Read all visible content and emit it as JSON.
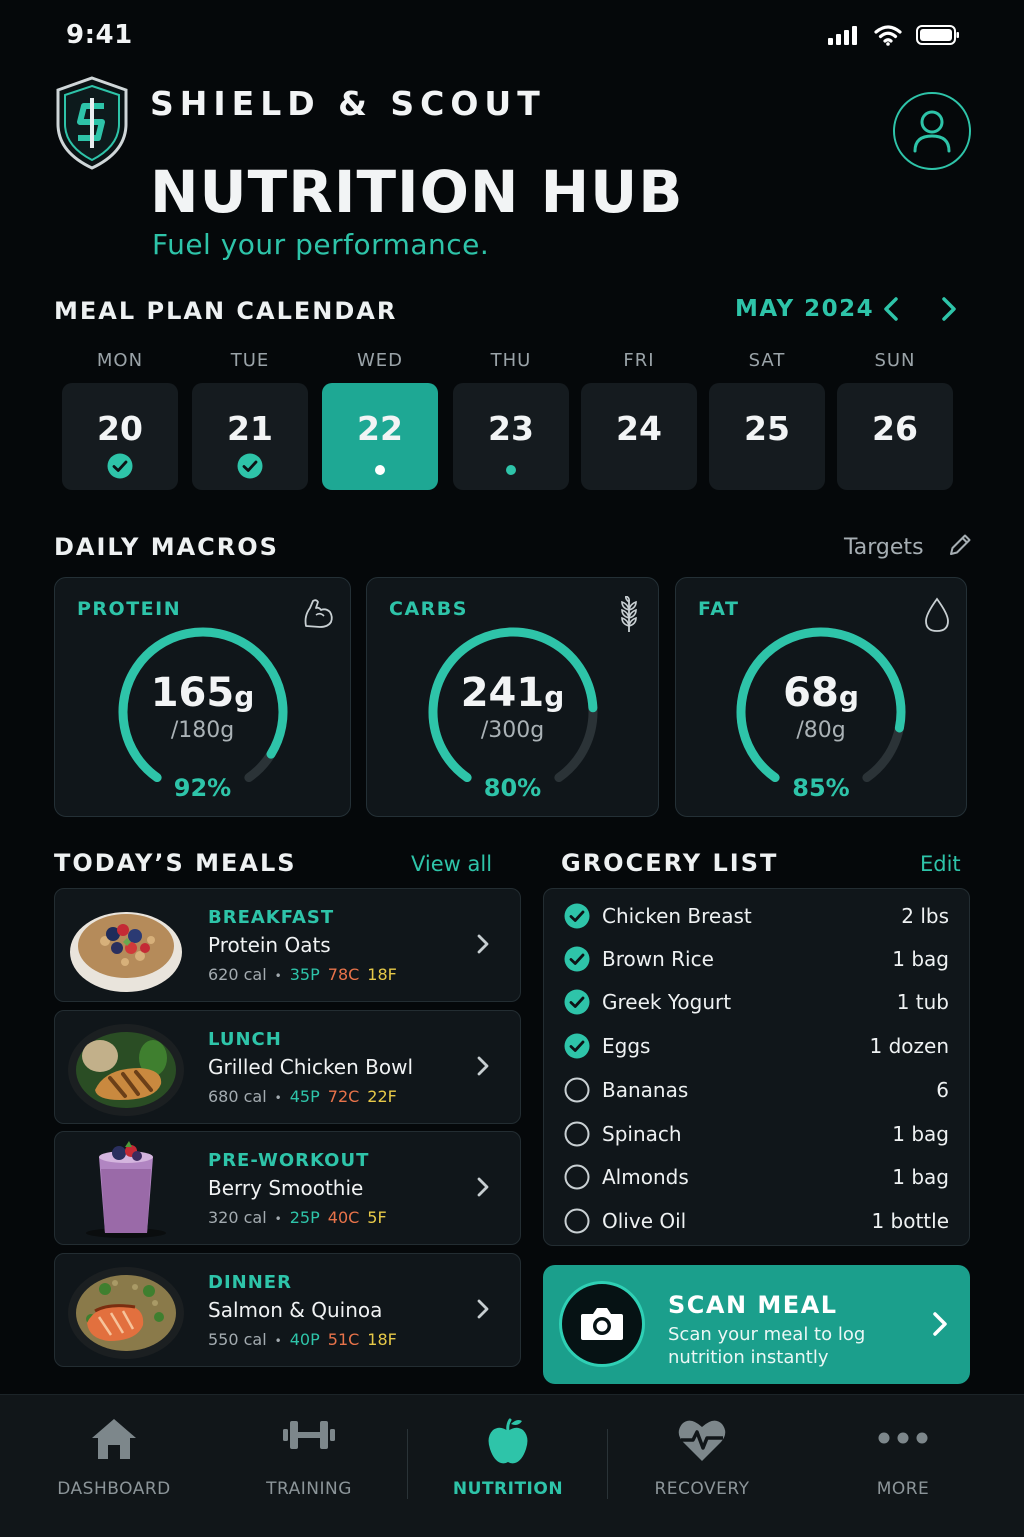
{
  "status": {
    "time": "9:41"
  },
  "header": {
    "brand": "SHIELD & SCOUT",
    "title": "NUTRITION HUB",
    "tagline": "Fuel your performance."
  },
  "calendar": {
    "title": "MEAL PLAN CALENDAR",
    "month": "MAY 2024",
    "days": [
      {
        "label": "MON",
        "date": "20",
        "state": "done"
      },
      {
        "label": "TUE",
        "date": "21",
        "state": "done"
      },
      {
        "label": "WED",
        "date": "22",
        "state": "selected"
      },
      {
        "label": "THU",
        "date": "23",
        "state": "planned"
      },
      {
        "label": "FRI",
        "date": "24",
        "state": "none"
      },
      {
        "label": "SAT",
        "date": "25",
        "state": "none"
      },
      {
        "label": "SUN",
        "date": "26",
        "state": "none"
      }
    ]
  },
  "macros": {
    "title": "DAILY MACROS",
    "targets_label": "Targets",
    "items": [
      {
        "label": "PROTEIN",
        "value": "165",
        "unit": "g",
        "target": "/180g",
        "percent": "92%",
        "fraction": 0.92,
        "icon": "flexed-arm-icon"
      },
      {
        "label": "CARBS",
        "value": "241",
        "unit": "g",
        "target": "/300g",
        "percent": "80%",
        "fraction": 0.8,
        "icon": "wheat-icon"
      },
      {
        "label": "FAT",
        "value": "68",
        "unit": "g",
        "target": "/80g",
        "percent": "85%",
        "fraction": 0.85,
        "icon": "droplet-icon"
      }
    ]
  },
  "meals": {
    "title": "TODAY’S MEALS",
    "view_all": "View all",
    "items": [
      {
        "type": "BREAKFAST",
        "name": "Protein Oats",
        "cal": "620 cal",
        "p": "35P",
        "c": "78C",
        "f": "18F"
      },
      {
        "type": "LUNCH",
        "name": "Grilled Chicken Bowl",
        "cal": "680 cal",
        "p": "45P",
        "c": "72C",
        "f": "22F"
      },
      {
        "type": "PRE-WORKOUT",
        "name": "Berry Smoothie",
        "cal": "320 cal",
        "p": "25P",
        "c": "40C",
        "f": "5F"
      },
      {
        "type": "DINNER",
        "name": "Salmon & Quinoa",
        "cal": "550 cal",
        "p": "40P",
        "c": "51C",
        "f": "18F"
      }
    ]
  },
  "grocery": {
    "title": "GROCERY LIST",
    "edit": "Edit",
    "items": [
      {
        "name": "Chicken Breast",
        "qty": "2 lbs",
        "checked": true
      },
      {
        "name": "Brown Rice",
        "qty": "1 bag",
        "checked": true
      },
      {
        "name": "Greek Yogurt",
        "qty": "1 tub",
        "checked": true
      },
      {
        "name": "Eggs",
        "qty": "1 dozen",
        "checked": true
      },
      {
        "name": "Bananas",
        "qty": "6",
        "checked": false
      },
      {
        "name": "Spinach",
        "qty": "1 bag",
        "checked": false
      },
      {
        "name": "Almonds",
        "qty": "1 bag",
        "checked": false
      },
      {
        "name": "Olive Oil",
        "qty": "1 bottle",
        "checked": false
      }
    ]
  },
  "scan": {
    "title": "SCAN MEAL",
    "subtitle": "Scan your meal to log nutrition instantly"
  },
  "nav": {
    "items": [
      {
        "label": "DASHBOARD",
        "icon": "house-icon",
        "active": false
      },
      {
        "label": "TRAINING",
        "icon": "dumbbell-icon",
        "active": false
      },
      {
        "label": "NUTRITION",
        "icon": "apple-icon",
        "active": true
      },
      {
        "label": "RECOVERY",
        "icon": "heartbeat-icon",
        "active": false
      },
      {
        "label": "MORE",
        "icon": "more-dots-icon",
        "active": false
      }
    ]
  },
  "colors": {
    "accent": "#2ec4a9",
    "background": "#05080a",
    "card": "#10161a",
    "carbs": "#e8734a",
    "fat": "#e7c948"
  }
}
